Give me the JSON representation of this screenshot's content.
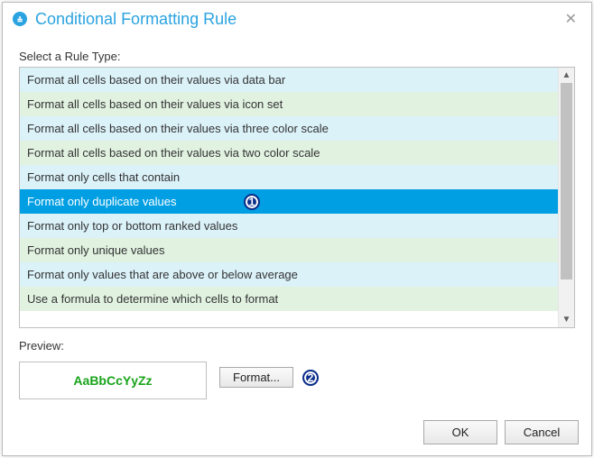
{
  "title": "Conditional Formatting Rule",
  "section_label": "Select a Rule Type:",
  "rule_types": [
    "Format all cells based on their values via data bar",
    "Format all cells based on their values via icon set",
    "Format all cells based on their values via three color scale",
    "Format all cells based on their values via two color scale",
    "Format only cells that contain",
    "Format only duplicate values",
    "Format only top or bottom ranked values",
    "Format only unique values",
    "Format only values that are above or below average",
    "Use a formula to determine which cells to format"
  ],
  "selected_index": 5,
  "preview_label": "Preview:",
  "preview_text": "AaBbCcYyZz",
  "preview_color": "#18a41a",
  "format_button": "Format...",
  "buttons": {
    "ok": "OK",
    "cancel": "Cancel"
  },
  "annotations": {
    "step1": "1",
    "step2": "2"
  },
  "accent_color": "#2aa3e0",
  "selection_color": "#009fe3"
}
